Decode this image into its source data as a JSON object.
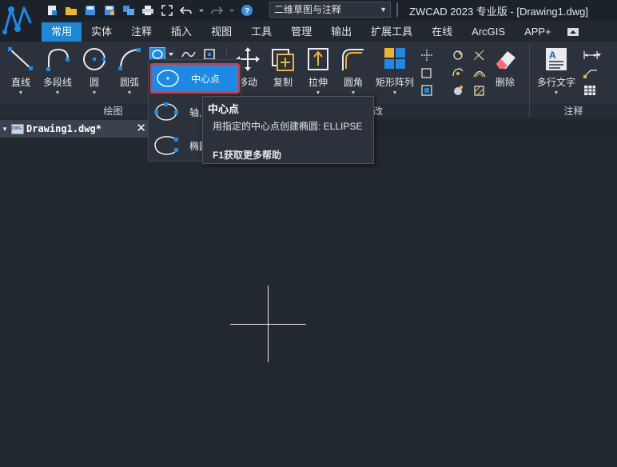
{
  "app": {
    "title": "ZWCAD 2023 专业版 - [Drawing1.dwg]",
    "workspace": "二维草图与注释",
    "accent_color": "#1e88d6"
  },
  "quick_access": [
    "new-icon",
    "open-icon",
    "save-icon",
    "saveas-icon",
    "multi-save-icon",
    "print-icon",
    "fullscreen-icon",
    "undo-icon",
    "redo-icon",
    "help-icon"
  ],
  "tabs": [
    "常用",
    "实体",
    "注释",
    "插入",
    "视图",
    "工具",
    "管理",
    "输出",
    "扩展工具",
    "在线",
    "ArcGIS",
    "APP+"
  ],
  "ribbon": {
    "draw": {
      "footer": "绘图",
      "tools": {
        "line": "直线",
        "polyline": "多段线",
        "circle": "圆",
        "arc": "圆弧"
      }
    },
    "modify": {
      "footer": "改",
      "tools": {
        "move": "移动",
        "copy": "复制",
        "stretch": "拉伸",
        "fillet": "圆角",
        "array": "矩形阵列",
        "erase": "删除"
      }
    },
    "annotation": {
      "footer": "注释",
      "tools": {
        "mtext": "多行文字"
      }
    }
  },
  "document": {
    "tab_name": "Drawing1.dwg*"
  },
  "ellipse_flyout": {
    "items": [
      "中心点",
      "轴,",
      "椭圆"
    ],
    "selected": "中心点"
  },
  "tooltip": {
    "title": "中心点",
    "description": "用指定的中心点创建椭圆: ELLIPSE",
    "help": "F1获取更多帮助"
  }
}
